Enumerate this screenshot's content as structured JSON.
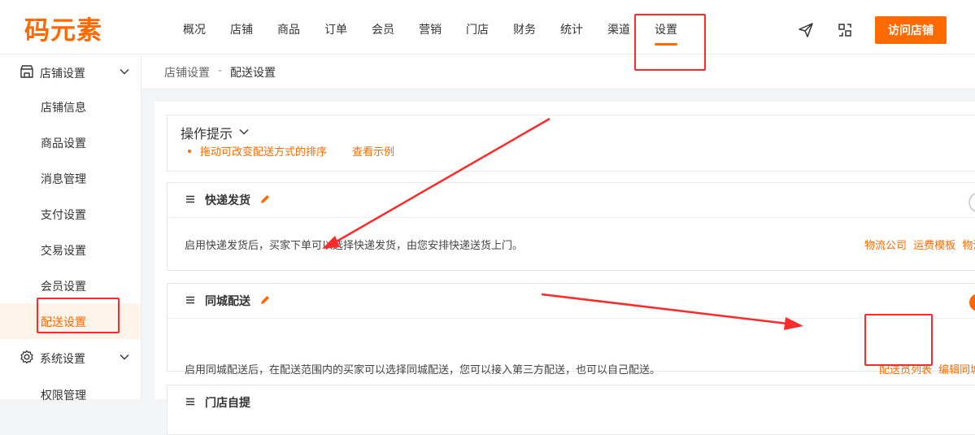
{
  "brand": {
    "logo": "码元素",
    "accent": "#ff6a00"
  },
  "nav": {
    "items": [
      "概况",
      "店铺",
      "商品",
      "订单",
      "会员",
      "营销",
      "门店",
      "财务",
      "统计",
      "渠道",
      "设置"
    ],
    "active": "设置",
    "icons": [
      "send-icon",
      "switch-icon"
    ],
    "visit_button": "访问店铺"
  },
  "sidebar": {
    "group1": {
      "label": "店铺设置",
      "icon": "store-icon"
    },
    "items": [
      "店铺信息",
      "商品设置",
      "消息管理",
      "支付设置",
      "交易设置",
      "会员设置",
      "配送设置"
    ],
    "active": "配送设置",
    "group2": {
      "label": "系统设置",
      "icon": "gear-icon"
    },
    "group2_items": [
      "权限管理"
    ]
  },
  "breadcrumb": {
    "parent": "店铺设置",
    "sep": "-",
    "current": "配送设置"
  },
  "tips": {
    "title": "操作提示",
    "text": "拖动可改变配送方式的排序",
    "link": "查看示例"
  },
  "delivery_methods": [
    {
      "title": "快递发货",
      "description": "启用快递发货后，买家下单可以选择快递发货，由您安排快递送货上门。",
      "links": [
        "物流公司",
        "运费模板",
        "物流"
      ],
      "enabled": false
    },
    {
      "title": "同城配送",
      "description": "启用同城配送后，在配送范围内的买家可以选择同城配送，您可以接入第三方配送，也可以自己配送。",
      "links": [
        "配送员列表",
        "编辑同城"
      ],
      "enabled": true
    },
    {
      "title": "门店自提"
    }
  ]
}
